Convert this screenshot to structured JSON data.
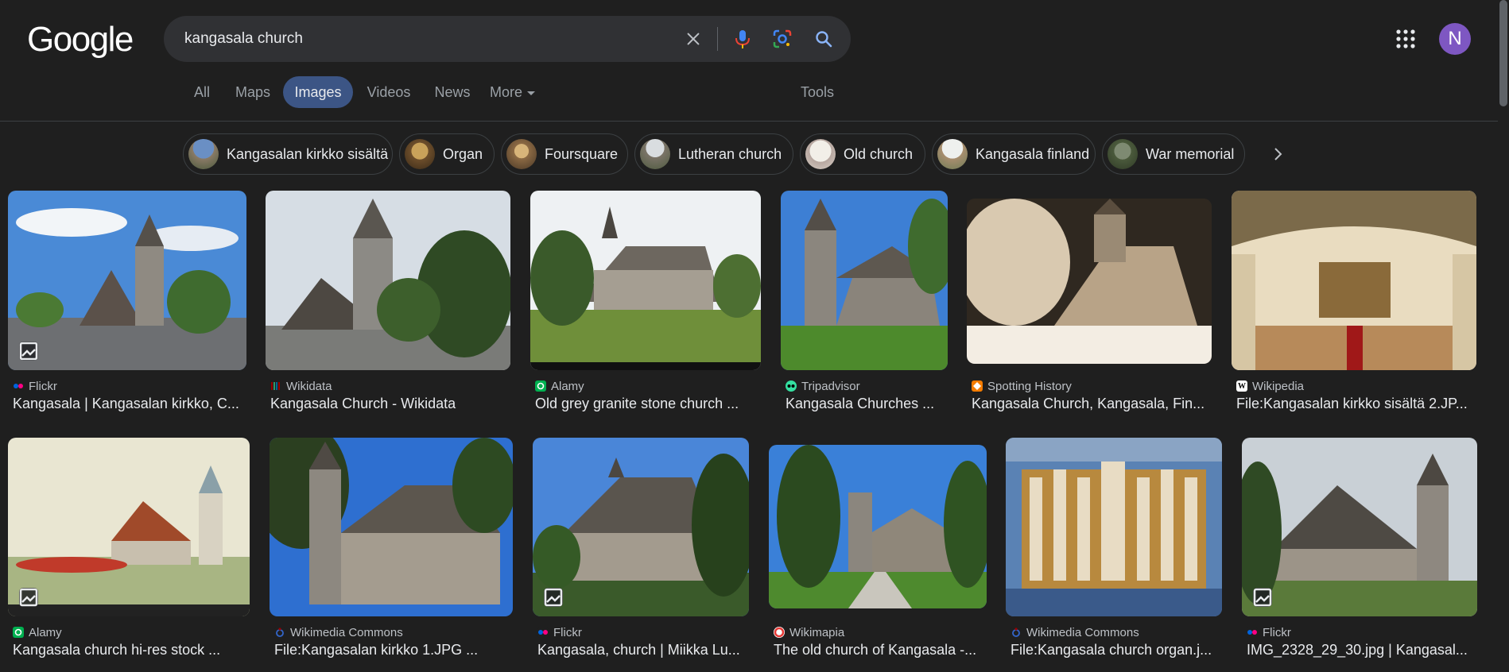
{
  "header": {
    "logo": "Google",
    "search_query": "kangasala church",
    "avatar_letter": "N"
  },
  "nav": {
    "tabs": [
      {
        "label": "All"
      },
      {
        "label": "Maps"
      },
      {
        "label": "Images",
        "active": true
      },
      {
        "label": "Videos"
      },
      {
        "label": "News"
      },
      {
        "label": "More"
      }
    ],
    "tools": "Tools"
  },
  "chips": [
    {
      "label": "Kangasalan kirkko sisältä"
    },
    {
      "label": "Organ"
    },
    {
      "label": "Foursquare"
    },
    {
      "label": "Lutheran church"
    },
    {
      "label": "Old church"
    },
    {
      "label": "Kangasala finland"
    },
    {
      "label": "War memorial"
    }
  ],
  "results": [
    {
      "source": "Flickr",
      "title": "Kangasala | Kangasalan kirkko, C...",
      "favicon_color": "#ff0084"
    },
    {
      "source": "Wikidata",
      "title": "Kangasala Church - Wikidata",
      "favicon_color": "#990000"
    },
    {
      "source": "Alamy",
      "title": "Old grey granite stone church ...",
      "favicon_color": "#00b050"
    },
    {
      "source": "Tripadvisor",
      "title": "Kangasala Churches ...",
      "favicon_color": "#34e0a1"
    },
    {
      "source": "Spotting History",
      "title": "Kangasala Church, Kangasala, Fin...",
      "favicon_color": "#f57c00"
    },
    {
      "source": "Wikipedia",
      "title": "File:Kangasalan kirkko sisältä 2.JP...",
      "favicon_color": "#ffffff"
    },
    {
      "source": "Alamy",
      "title": "Kangasala church hi-res stock ...",
      "favicon_color": "#00b050"
    },
    {
      "source": "Wikimedia Commons",
      "title": "File:Kangasalan kirkko 1.JPG ...",
      "favicon_color": "#3366cc"
    },
    {
      "source": "Flickr",
      "title": "Kangasala, church | Miikka Lu...",
      "favicon_color": "#ff0084"
    },
    {
      "source": "Wikimapia",
      "title": "The old church of Kangasala -...",
      "favicon_color": "#e53935"
    },
    {
      "source": "Wikimedia Commons",
      "title": "File:Kangasala church organ.j...",
      "favicon_color": "#3366cc"
    },
    {
      "source": "Flickr",
      "title": "IMG_2328_29_30.jpg | Kangasal...",
      "favicon_color": "#ff0084"
    }
  ]
}
